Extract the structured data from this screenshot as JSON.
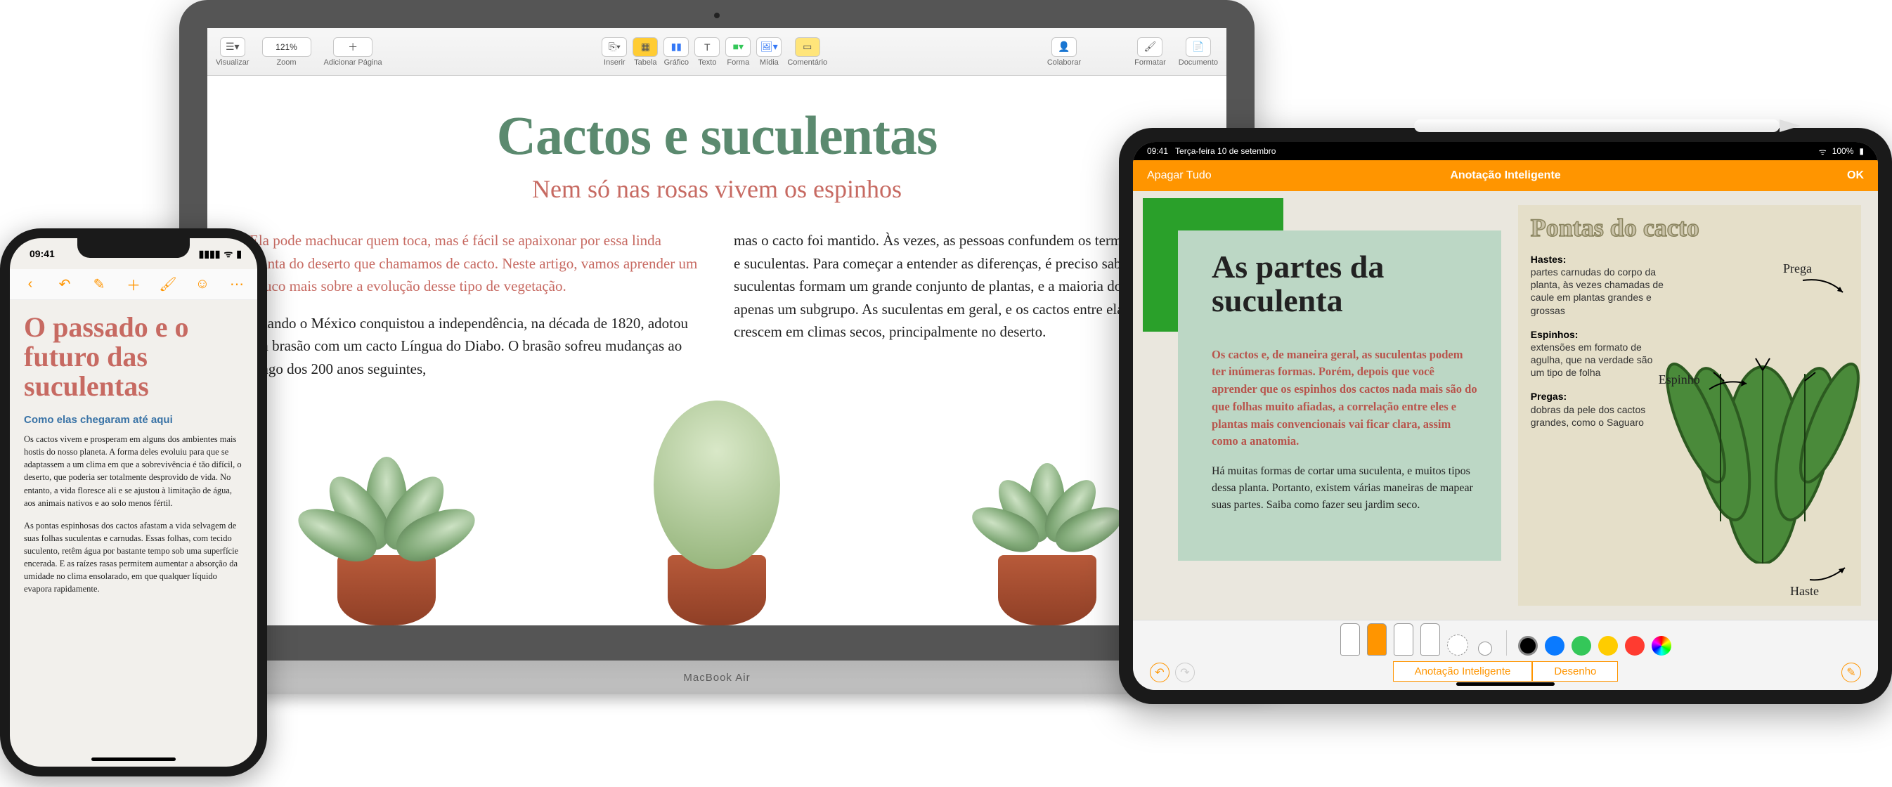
{
  "iphone": {
    "time": "09:41",
    "toolbar_icons": [
      "back",
      "undo",
      "highlighter",
      "add",
      "paint",
      "comment",
      "more"
    ],
    "title": "O passado e o futuro das suculentas",
    "subhead": "Como elas chegaram até aqui",
    "para1": "Os cactos vivem e prosperam em alguns dos ambientes mais hostis do nosso planeta. A forma deles evoluiu para que se adaptassem a um clima em que a sobrevivência é tão difícil, o deserto, que poderia ser totalmente desprovido de vida. No entanto, a vida floresce ali e se ajustou à limitação de água, aos animais nativos e ao solo menos fértil.",
    "para2": "As pontas espinhosas dos cactos afastam a vida selvagem de suas folhas suculentas e carnudas. Essas folhas, com tecido suculento, retêm água por bastante tempo sob uma superfície encerada. E as raízes rasas permitem aumentar a absorção da umidade no clima ensolarado, em que qualquer líquido evapora rapidamente."
  },
  "mac": {
    "toolbar": {
      "visualizar": "Visualizar",
      "zoom_label": "Zoom",
      "zoom_value": "121%",
      "adicionar_pagina": "Adicionar Página",
      "inserir": "Inserir",
      "tabela": "Tabela",
      "grafico": "Gráfico",
      "texto": "Texto",
      "forma": "Forma",
      "midia": "Mídia",
      "comentario": "Comentário",
      "colaborar": "Colaborar",
      "formatar": "Formatar",
      "documento": "Documento"
    },
    "h1": "Cactos e suculentas",
    "h2": "Nem só nas rosas vivem os espinhos",
    "intro": "Ela pode machucar quem toca, mas é fácil se apaixonar por essa linda planta do deserto que chamamos de cacto. Neste artigo, vamos aprender um pouco mais sobre a evolução desse tipo de vegetação.",
    "col1_p2": "Quando o México conquistou a independência, na década de 1820, adotou um brasão com um cacto Língua do Diabo. O brasão sofreu mudanças ao longo dos 200 anos seguintes,",
    "col2": "mas o cacto foi mantido. Às vezes, as pessoas confundem os termos cactos e suculentas. Para começar a entender as diferenças, é preciso saber que as suculentas formam um grande conjunto de plantas, e a maioria dos cactos é apenas um subgrupo. As suculentas em geral, e os cactos entre elas, crescem em climas secos, principalmente no deserto.",
    "base_label": "MacBook Air"
  },
  "ipad": {
    "time": "09:41",
    "date": "Terça-feira 10 de setembro",
    "battery": "100%",
    "nav_left": "Apagar Tudo",
    "nav_title": "Anotação Inteligente",
    "nav_right": "OK",
    "left": {
      "h1": "As partes da suculenta",
      "intro": "Os cactos e, de maneira geral, as suculentas podem ter inúmeras formas. Porém, depois que você aprender que os espinhos dos cactos nada mais são do que folhas muito afiadas, a correlação entre eles e plantas mais convencionais vai ficar clara, assim como a anatomia.",
      "body": "Há muitas formas de cortar uma suculenta, e muitos tipos dessa planta. Portanto, existem várias maneiras de mapear suas partes. Saiba como fazer seu jardim seco."
    },
    "right": {
      "h": "Pontas do cacto",
      "defs": [
        {
          "term": "Hastes:",
          "text": "partes carnudas do corpo da planta, às vezes chamadas de caule em plantas grandes e grossas"
        },
        {
          "term": "Espinhos:",
          "text": "extensões em formato de agulha, que na verdade são um tipo de folha"
        },
        {
          "term": "Pregas:",
          "text": "dobras da pele dos cactos grandes, como o Saguaro"
        }
      ],
      "anno_prega": "Prega",
      "anno_espinho": "Espinho",
      "anno_haste": "Haste"
    },
    "bottombar": {
      "seg_smart": "Anotação Inteligente",
      "seg_draw": "Desenho",
      "colors": [
        "#000000",
        "#0a7aff",
        "#34c759",
        "#ffcc00",
        "#ff3b30"
      ]
    }
  }
}
